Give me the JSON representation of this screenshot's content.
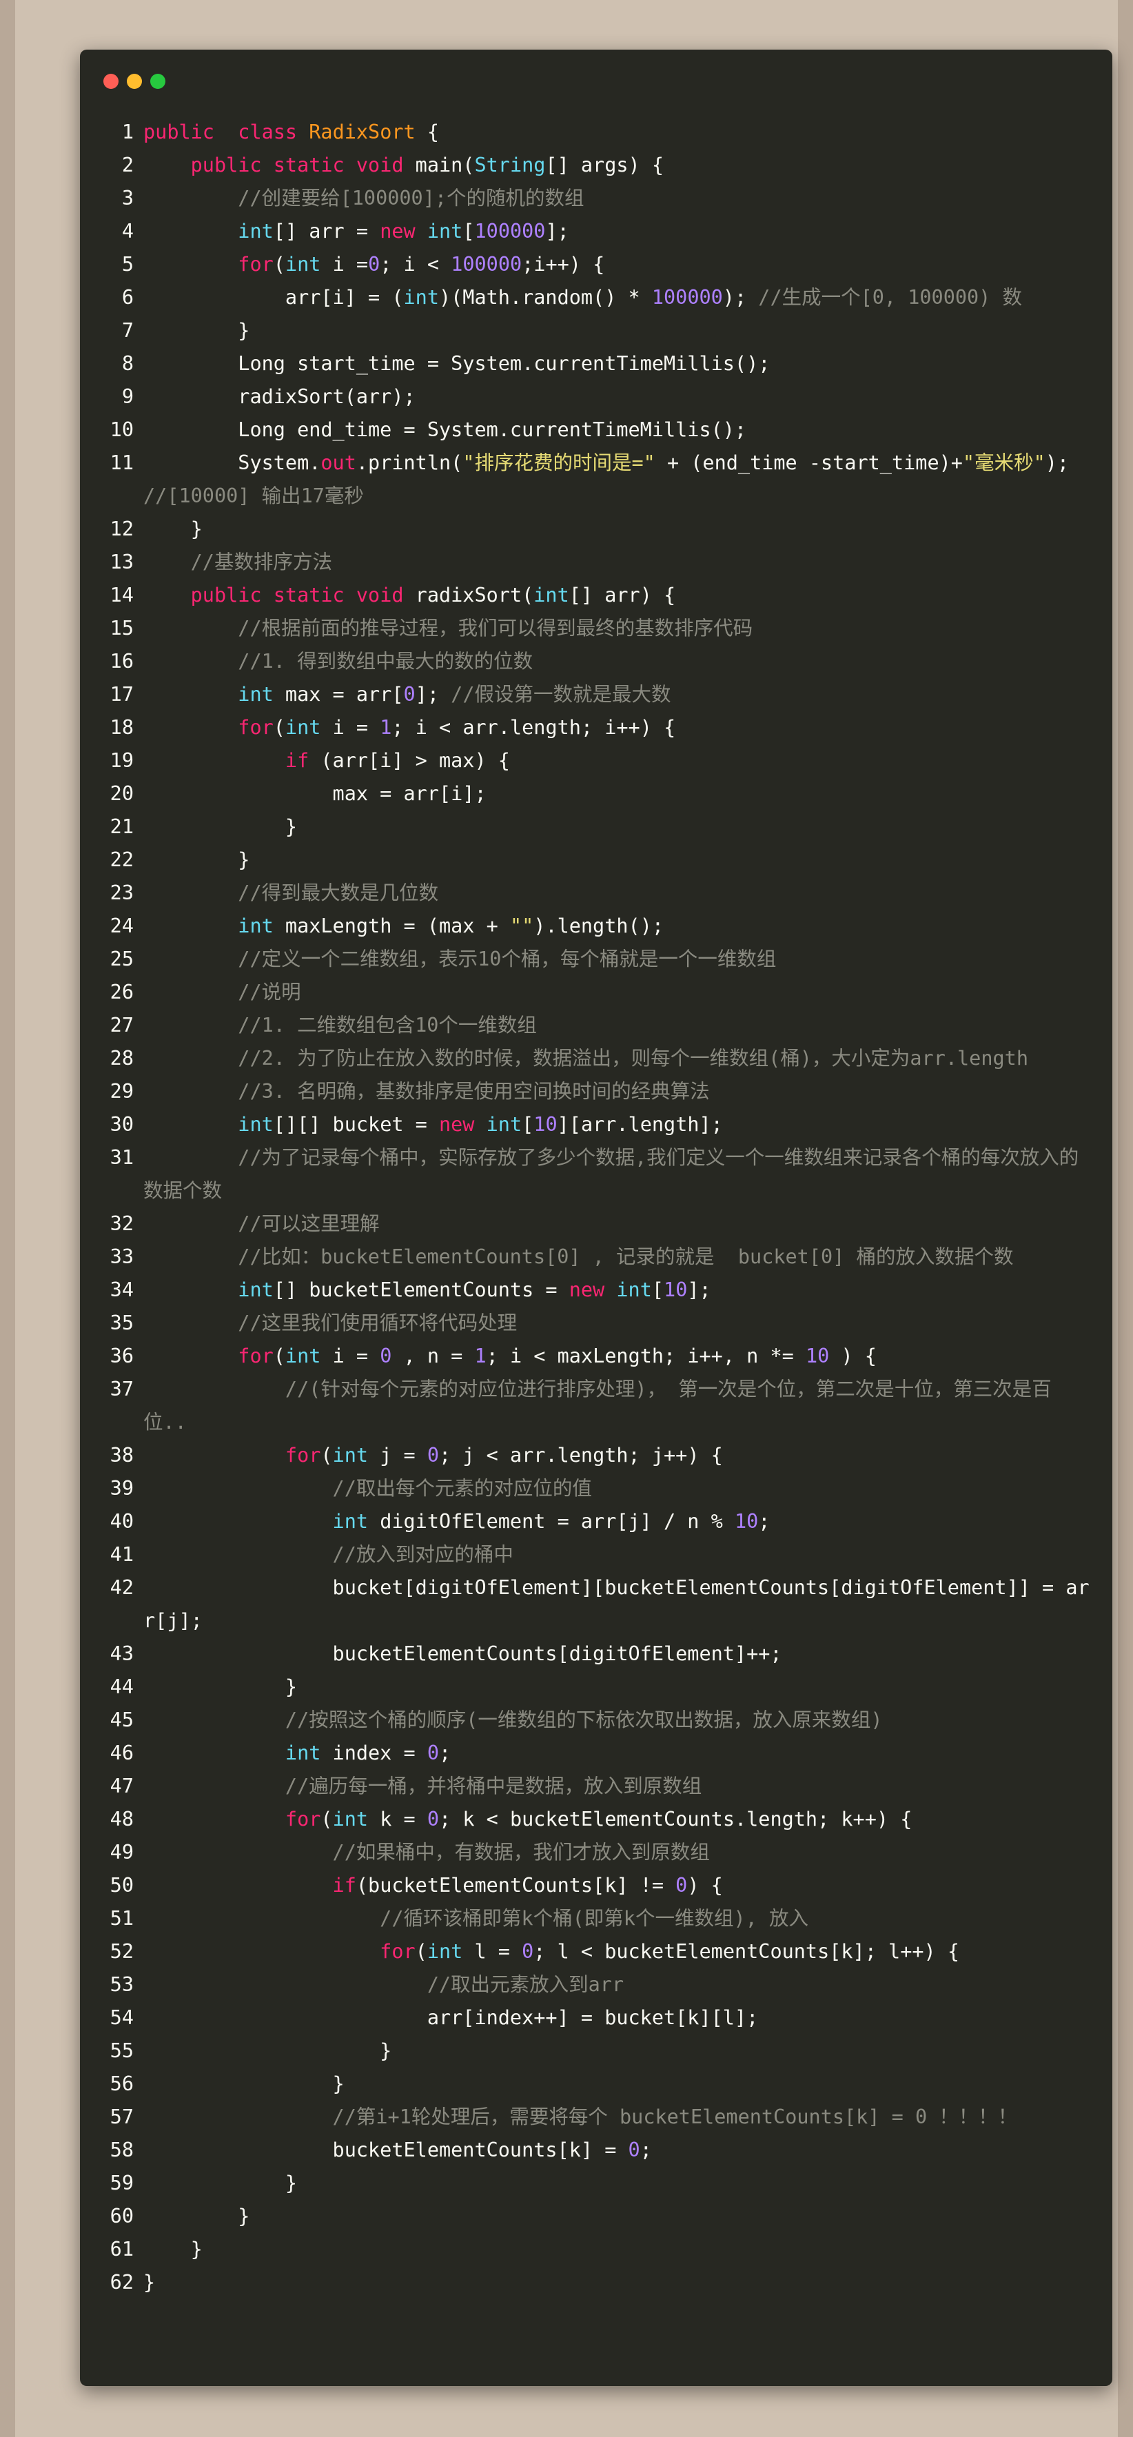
{
  "window": {
    "controls": [
      "close",
      "minimize",
      "maximize"
    ],
    "colors": {
      "close": "#ff5f56",
      "minimize": "#ffbd2e",
      "maximize": "#27c93f",
      "background": "#272822"
    }
  },
  "syntax_colors": {
    "comment": "#8a8a80",
    "keyword": "#f92672",
    "type": "#66d9ef",
    "class": "#fd971f",
    "number": "#ae81ff",
    "string": "#e6db74",
    "text": "#f8f8f2"
  },
  "code": {
    "language": "java",
    "lines": [
      {
        "n": "1",
        "s": [
          [
            "kw",
            "public"
          ],
          [
            "",
            "  "
          ],
          [
            "kw",
            "class"
          ],
          [
            "",
            " "
          ],
          [
            "cl",
            "RadixSort"
          ],
          [
            "",
            " {"
          ]
        ]
      },
      {
        "n": "2",
        "s": [
          [
            "",
            "    "
          ],
          [
            "kw",
            "public static"
          ],
          [
            "",
            " "
          ],
          [
            "kw",
            "void"
          ],
          [
            "",
            " main("
          ],
          [
            "ty",
            "String"
          ],
          [
            "",
            "[] args) {"
          ]
        ]
      },
      {
        "n": "3",
        "s": [
          [
            "",
            "        "
          ],
          [
            "c",
            "//创建要给[100000];个的随机的数组"
          ]
        ]
      },
      {
        "n": "4",
        "s": [
          [
            "",
            "        "
          ],
          [
            "ty",
            "int"
          ],
          [
            "",
            "[] arr = "
          ],
          [
            "kw",
            "new"
          ],
          [
            "",
            " "
          ],
          [
            "ty",
            "int"
          ],
          [
            "",
            "["
          ],
          [
            "nu",
            "100000"
          ],
          [
            "",
            "];"
          ]
        ]
      },
      {
        "n": "5",
        "s": [
          [
            "",
            "        "
          ],
          [
            "kw",
            "for"
          ],
          [
            "",
            "("
          ],
          [
            "ty",
            "int"
          ],
          [
            "",
            " i ="
          ],
          [
            "nu",
            "0"
          ],
          [
            "",
            "; i < "
          ],
          [
            "nu",
            "100000"
          ],
          [
            "",
            ";i++) {"
          ]
        ]
      },
      {
        "n": "6",
        "s": [
          [
            "",
            "            arr[i] = ("
          ],
          [
            "ty",
            "int"
          ],
          [
            "",
            ")(Math.random() * "
          ],
          [
            "nu",
            "100000"
          ],
          [
            "",
            "); "
          ],
          [
            "c",
            "//生成一个[0, 100000) 数"
          ]
        ]
      },
      {
        "n": "7",
        "s": [
          [
            "",
            "        }"
          ]
        ]
      },
      {
        "n": "8",
        "s": [
          [
            "",
            "        Long start_time = System.currentTimeMillis();"
          ]
        ]
      },
      {
        "n": "9",
        "s": [
          [
            "",
            "        radixSort(arr);"
          ]
        ]
      },
      {
        "n": "10",
        "s": [
          [
            "",
            "        Long end_time = System.currentTimeMillis();"
          ]
        ]
      },
      {
        "n": "11",
        "s": [
          [
            "",
            "        System."
          ],
          [
            "kw",
            "out"
          ],
          [
            "",
            ".println("
          ],
          [
            "st",
            "\"排序花费的时间是=\""
          ],
          [
            "",
            " + (end_time -start_time)+"
          ],
          [
            "st",
            "\"毫米秒\""
          ],
          [
            "",
            "); "
          ],
          [
            "c",
            "//[10000] 输出17毫秒"
          ]
        ]
      },
      {
        "n": "12",
        "s": [
          [
            "",
            "    }"
          ]
        ]
      },
      {
        "n": "13",
        "s": [
          [
            "",
            "    "
          ],
          [
            "c",
            "//基数排序方法"
          ]
        ]
      },
      {
        "n": "14",
        "s": [
          [
            "",
            "    "
          ],
          [
            "kw",
            "public static"
          ],
          [
            "",
            " "
          ],
          [
            "kw",
            "void"
          ],
          [
            "",
            " radixSort("
          ],
          [
            "ty",
            "int"
          ],
          [
            "",
            "[] arr) {"
          ]
        ]
      },
      {
        "n": "15",
        "s": [
          [
            "",
            "        "
          ],
          [
            "c",
            "//根据前面的推导过程，我们可以得到最终的基数排序代码"
          ]
        ]
      },
      {
        "n": "16",
        "s": [
          [
            "",
            "        "
          ],
          [
            "c",
            "//1. 得到数组中最大的数的位数"
          ]
        ]
      },
      {
        "n": "17",
        "s": [
          [
            "",
            "        "
          ],
          [
            "ty",
            "int"
          ],
          [
            "",
            " max = arr["
          ],
          [
            "nu",
            "0"
          ],
          [
            "",
            "]; "
          ],
          [
            "c",
            "//假设第一数就是最大数"
          ]
        ]
      },
      {
        "n": "18",
        "s": [
          [
            "",
            "        "
          ],
          [
            "kw",
            "for"
          ],
          [
            "",
            "("
          ],
          [
            "ty",
            "int"
          ],
          [
            "",
            " i = "
          ],
          [
            "nu",
            "1"
          ],
          [
            "",
            "; i < arr.length; i++) {"
          ]
        ]
      },
      {
        "n": "19",
        "s": [
          [
            "",
            "            "
          ],
          [
            "kw",
            "if"
          ],
          [
            "",
            " (arr[i] > max) {"
          ]
        ]
      },
      {
        "n": "20",
        "s": [
          [
            "",
            "                max = arr[i];"
          ]
        ]
      },
      {
        "n": "21",
        "s": [
          [
            "",
            "            }"
          ]
        ]
      },
      {
        "n": "22",
        "s": [
          [
            "",
            "        }"
          ]
        ]
      },
      {
        "n": "23",
        "s": [
          [
            "",
            "        "
          ],
          [
            "c",
            "//得到最大数是几位数"
          ]
        ]
      },
      {
        "n": "24",
        "s": [
          [
            "",
            "        "
          ],
          [
            "ty",
            "int"
          ],
          [
            "",
            " maxLength = (max + "
          ],
          [
            "st",
            "\"\""
          ],
          [
            "",
            ").length();"
          ]
        ]
      },
      {
        "n": "25",
        "s": [
          [
            "",
            "        "
          ],
          [
            "c",
            "//定义一个二维数组，表示10个桶，每个桶就是一个一维数组"
          ]
        ]
      },
      {
        "n": "26",
        "s": [
          [
            "",
            "        "
          ],
          [
            "c",
            "//说明"
          ]
        ]
      },
      {
        "n": "27",
        "s": [
          [
            "",
            "        "
          ],
          [
            "c",
            "//1. 二维数组包含10个一维数组"
          ]
        ]
      },
      {
        "n": "28",
        "s": [
          [
            "",
            "        "
          ],
          [
            "c",
            "//2. 为了防止在放入数的时候，数据溢出，则每个一维数组(桶)，大小定为arr.length"
          ]
        ]
      },
      {
        "n": "29",
        "s": [
          [
            "",
            "        "
          ],
          [
            "c",
            "//3. 名明确，基数排序是使用空间换时间的经典算法"
          ]
        ]
      },
      {
        "n": "30",
        "s": [
          [
            "",
            "        "
          ],
          [
            "ty",
            "int"
          ],
          [
            "",
            "[][] bucket = "
          ],
          [
            "kw",
            "new"
          ],
          [
            "",
            " "
          ],
          [
            "ty",
            "int"
          ],
          [
            "",
            "["
          ],
          [
            "nu",
            "10"
          ],
          [
            "",
            "][arr.length];"
          ]
        ]
      },
      {
        "n": "31",
        "s": [
          [
            "",
            "        "
          ],
          [
            "c",
            "//为了记录每个桶中，实际存放了多少个数据,我们定义一个一维数组来记录各个桶的每次放入的数据个数"
          ]
        ]
      },
      {
        "n": "32",
        "s": [
          [
            "",
            "        "
          ],
          [
            "c",
            "//可以这里理解"
          ]
        ]
      },
      {
        "n": "33",
        "s": [
          [
            "",
            "        "
          ],
          [
            "c",
            "//比如：bucketElementCounts[0] , 记录的就是  bucket[0] 桶的放入数据个数"
          ]
        ]
      },
      {
        "n": "34",
        "s": [
          [
            "",
            "        "
          ],
          [
            "ty",
            "int"
          ],
          [
            "",
            "[] bucketElementCounts = "
          ],
          [
            "kw",
            "new"
          ],
          [
            "",
            " "
          ],
          [
            "ty",
            "int"
          ],
          [
            "",
            "["
          ],
          [
            "nu",
            "10"
          ],
          [
            "",
            "];"
          ]
        ]
      },
      {
        "n": "35",
        "s": [
          [
            "",
            "        "
          ],
          [
            "c",
            "//这里我们使用循环将代码处理"
          ]
        ]
      },
      {
        "n": "36",
        "s": [
          [
            "",
            "        "
          ],
          [
            "kw",
            "for"
          ],
          [
            "",
            "("
          ],
          [
            "ty",
            "int"
          ],
          [
            "",
            " i = "
          ],
          [
            "nu",
            "0"
          ],
          [
            "",
            " , n = "
          ],
          [
            "nu",
            "1"
          ],
          [
            "",
            "; i < maxLength; i++, n *= "
          ],
          [
            "nu",
            "10"
          ],
          [
            "",
            " ) {"
          ]
        ]
      },
      {
        "n": "37",
        "s": [
          [
            "",
            "            "
          ],
          [
            "c",
            "//(针对每个元素的对应位进行排序处理)， 第一次是个位，第二次是十位，第三次是百位.."
          ]
        ]
      },
      {
        "n": "38",
        "s": [
          [
            "",
            "            "
          ],
          [
            "kw",
            "for"
          ],
          [
            "",
            "("
          ],
          [
            "ty",
            "int"
          ],
          [
            "",
            " j = "
          ],
          [
            "nu",
            "0"
          ],
          [
            "",
            "; j < arr.length; j++) {"
          ]
        ]
      },
      {
        "n": "39",
        "s": [
          [
            "",
            "                "
          ],
          [
            "c",
            "//取出每个元素的对应位的值"
          ]
        ]
      },
      {
        "n": "40",
        "s": [
          [
            "",
            "                "
          ],
          [
            "ty",
            "int"
          ],
          [
            "",
            " digitOfElement = arr[j] / n % "
          ],
          [
            "nu",
            "10"
          ],
          [
            "",
            ";"
          ]
        ]
      },
      {
        "n": "41",
        "s": [
          [
            "",
            "                "
          ],
          [
            "c",
            "//放入到对应的桶中"
          ]
        ]
      },
      {
        "n": "42",
        "s": [
          [
            "",
            "                bucket[digitOfElement][bucketElementCounts[digitOfElement]] = arr[j];"
          ]
        ]
      },
      {
        "n": "43",
        "s": [
          [
            "",
            "                bucketElementCounts[digitOfElement]++;"
          ]
        ]
      },
      {
        "n": "44",
        "s": [
          [
            "",
            "            }"
          ]
        ]
      },
      {
        "n": "45",
        "s": [
          [
            "",
            "            "
          ],
          [
            "c",
            "//按照这个桶的顺序(一维数组的下标依次取出数据，放入原来数组)"
          ]
        ]
      },
      {
        "n": "46",
        "s": [
          [
            "",
            "            "
          ],
          [
            "ty",
            "int"
          ],
          [
            "",
            " index = "
          ],
          [
            "nu",
            "0"
          ],
          [
            "",
            ";"
          ]
        ]
      },
      {
        "n": "47",
        "s": [
          [
            "",
            "            "
          ],
          [
            "c",
            "//遍历每一桶，并将桶中是数据，放入到原数组"
          ]
        ]
      },
      {
        "n": "48",
        "s": [
          [
            "",
            "            "
          ],
          [
            "kw",
            "for"
          ],
          [
            "",
            "("
          ],
          [
            "ty",
            "int"
          ],
          [
            "",
            " k = "
          ],
          [
            "nu",
            "0"
          ],
          [
            "",
            "; k < bucketElementCounts.length; k++) {"
          ]
        ]
      },
      {
        "n": "49",
        "s": [
          [
            "",
            "                "
          ],
          [
            "c",
            "//如果桶中，有数据，我们才放入到原数组"
          ]
        ]
      },
      {
        "n": "50",
        "s": [
          [
            "",
            "                "
          ],
          [
            "kw",
            "if"
          ],
          [
            "",
            "(bucketElementCounts[k] != "
          ],
          [
            "nu",
            "0"
          ],
          [
            "",
            ") {"
          ]
        ]
      },
      {
        "n": "51",
        "s": [
          [
            "",
            "                    "
          ],
          [
            "c",
            "//循环该桶即第k个桶(即第k个一维数组), 放入"
          ]
        ]
      },
      {
        "n": "52",
        "s": [
          [
            "",
            "                    "
          ],
          [
            "kw",
            "for"
          ],
          [
            "",
            "("
          ],
          [
            "ty",
            "int"
          ],
          [
            "",
            " l = "
          ],
          [
            "nu",
            "0"
          ],
          [
            "",
            "; l < bucketElementCounts[k]; l++) {"
          ]
        ]
      },
      {
        "n": "53",
        "s": [
          [
            "",
            "                        "
          ],
          [
            "c",
            "//取出元素放入到arr"
          ]
        ]
      },
      {
        "n": "54",
        "s": [
          [
            "",
            "                        arr[index++] = bucket[k][l];"
          ]
        ]
      },
      {
        "n": "55",
        "s": [
          [
            "",
            "                    }"
          ]
        ]
      },
      {
        "n": "56",
        "s": [
          [
            "",
            "                }"
          ]
        ]
      },
      {
        "n": "57",
        "s": [
          [
            "",
            "                "
          ],
          [
            "c",
            "//第i+1轮处理后，需要将每个 bucketElementCounts[k] = 0 ！！！！"
          ]
        ]
      },
      {
        "n": "58",
        "s": [
          [
            "",
            "                bucketElementCounts[k] = "
          ],
          [
            "nu",
            "0"
          ],
          [
            "",
            ";"
          ]
        ]
      },
      {
        "n": "59",
        "s": [
          [
            "",
            "            }"
          ]
        ]
      },
      {
        "n": "60",
        "s": [
          [
            "",
            "        }"
          ]
        ]
      },
      {
        "n": "61",
        "s": [
          [
            "",
            "    }"
          ]
        ]
      },
      {
        "n": "62",
        "s": [
          [
            "",
            "}"
          ]
        ]
      }
    ]
  }
}
